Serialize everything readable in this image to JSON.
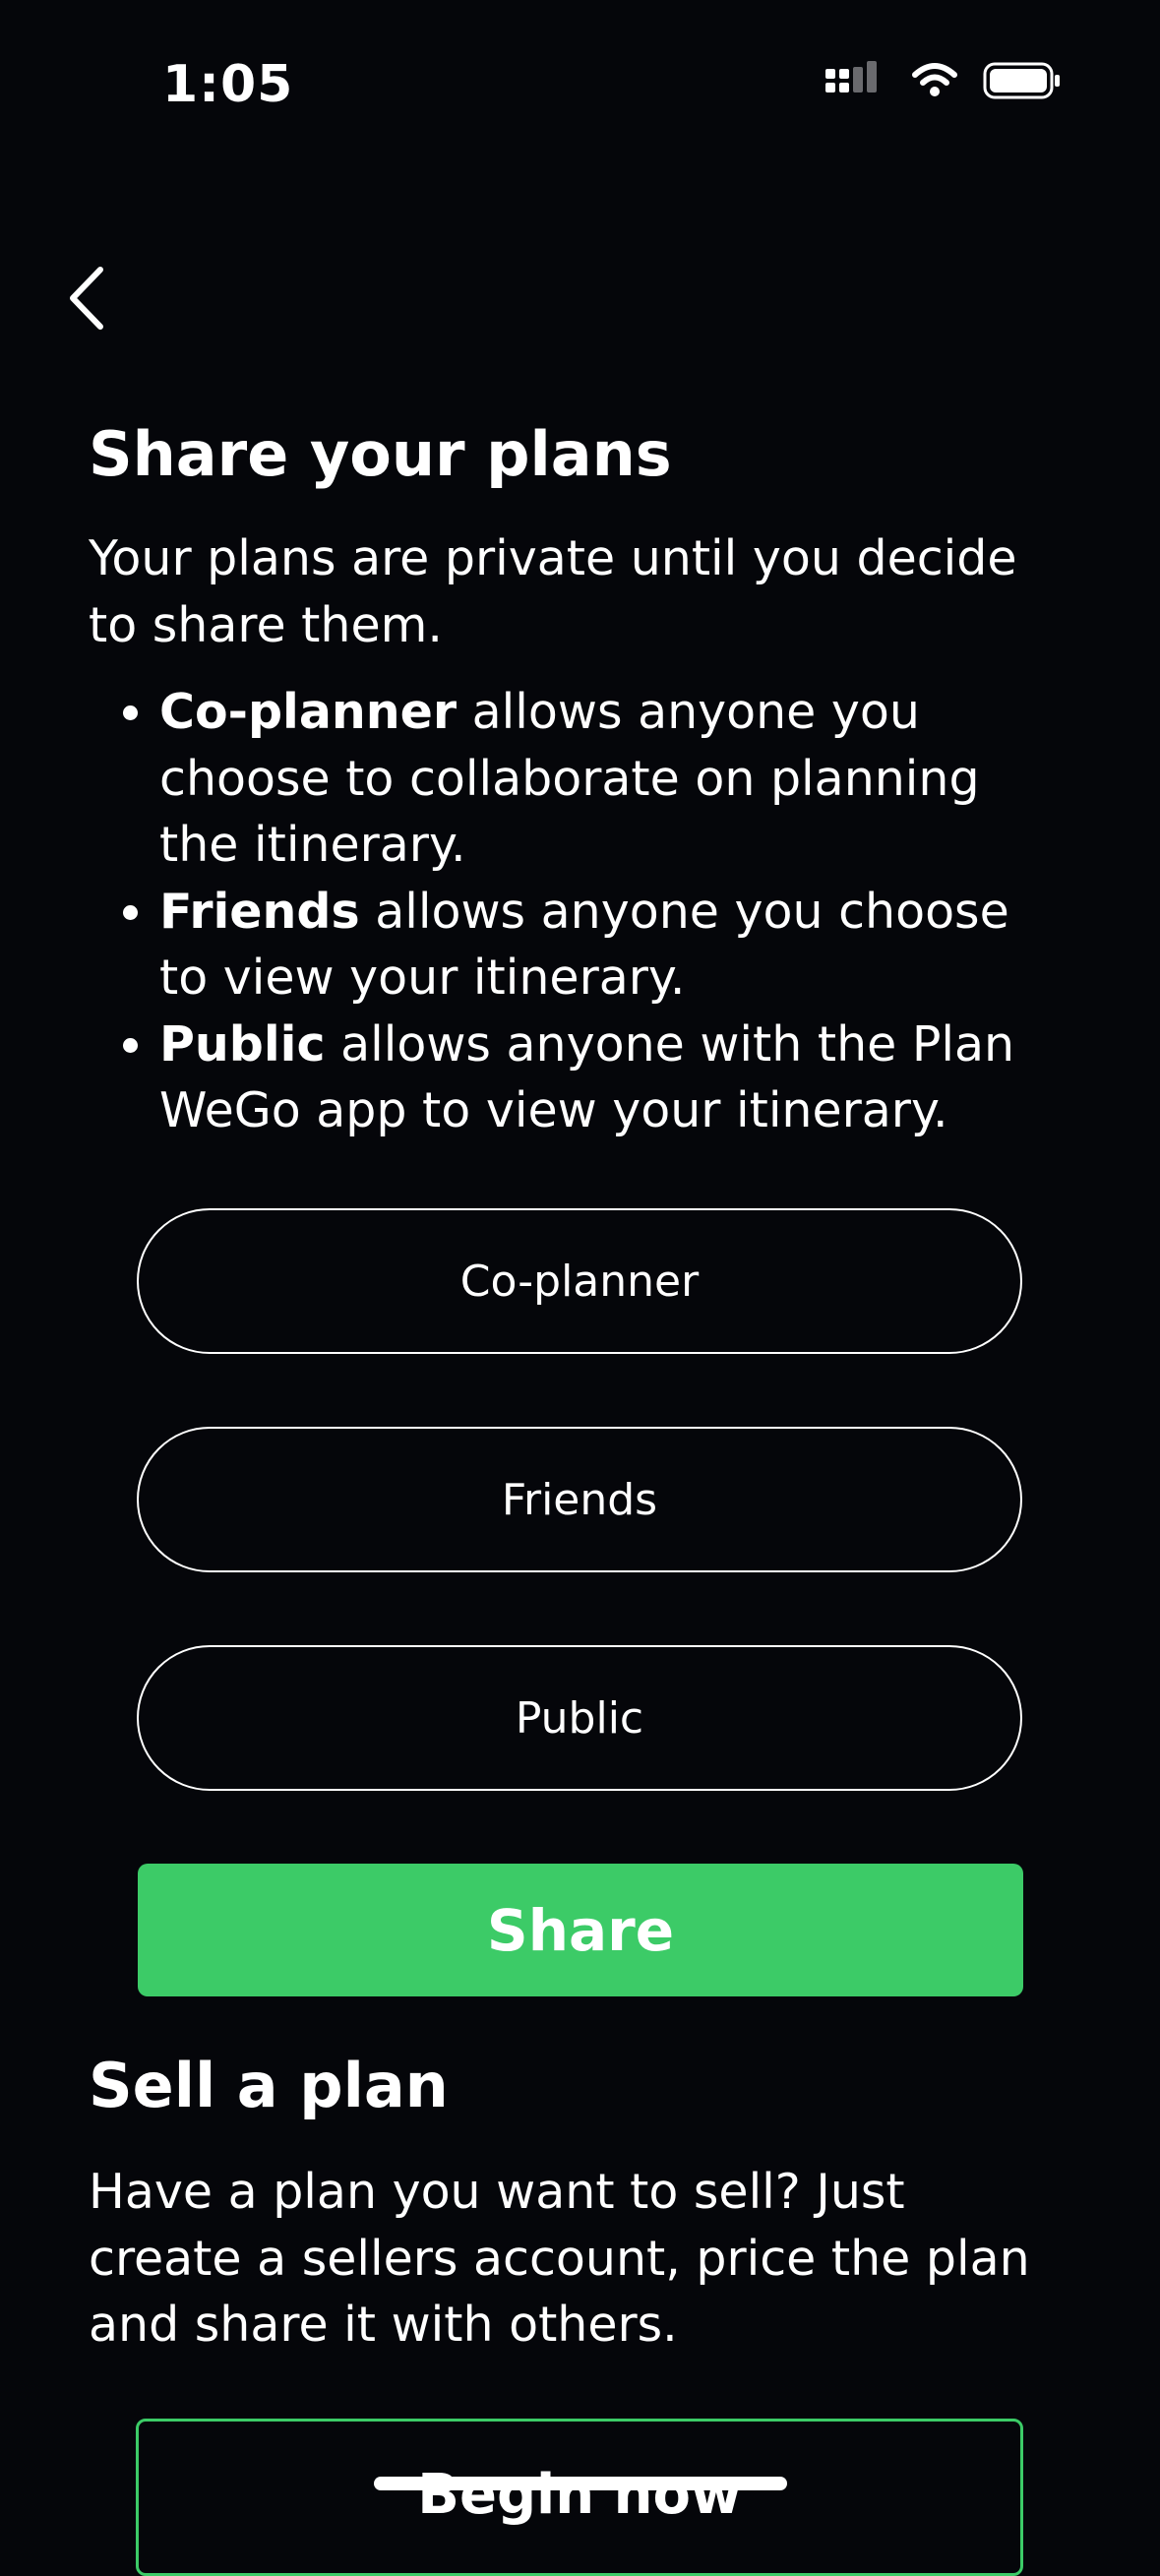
{
  "status_bar": {
    "time": "1:05",
    "icons": [
      "signal-icon",
      "wifi-icon",
      "battery-icon"
    ]
  },
  "nav": {
    "back_icon": "chevron-left-icon"
  },
  "share_section": {
    "title": "Share your plans",
    "intro": "Your plans are private until you decide to share them.",
    "bullets": [
      {
        "term": "Co-planner",
        "text": " allows anyone you choose to collaborate on planning the itinerary."
      },
      {
        "term": "Friends",
        "text": " allows anyone you choose to view your itinerary."
      },
      {
        "term": "Public",
        "text": " allows anyone with the Plan WeGo app to view your itinerary."
      }
    ],
    "options": [
      "Co-planner",
      "Friends",
      "Public"
    ],
    "share_label": "Share"
  },
  "sell_section": {
    "title": "Sell a plan",
    "description": "Have a plan you want to sell? Just create a sellers account, price the plan and share it with others.",
    "begin_label": "Begin now"
  },
  "colors": {
    "background": "#05060a",
    "accent_green": "#3ccb67",
    "text": "#ffffff"
  }
}
